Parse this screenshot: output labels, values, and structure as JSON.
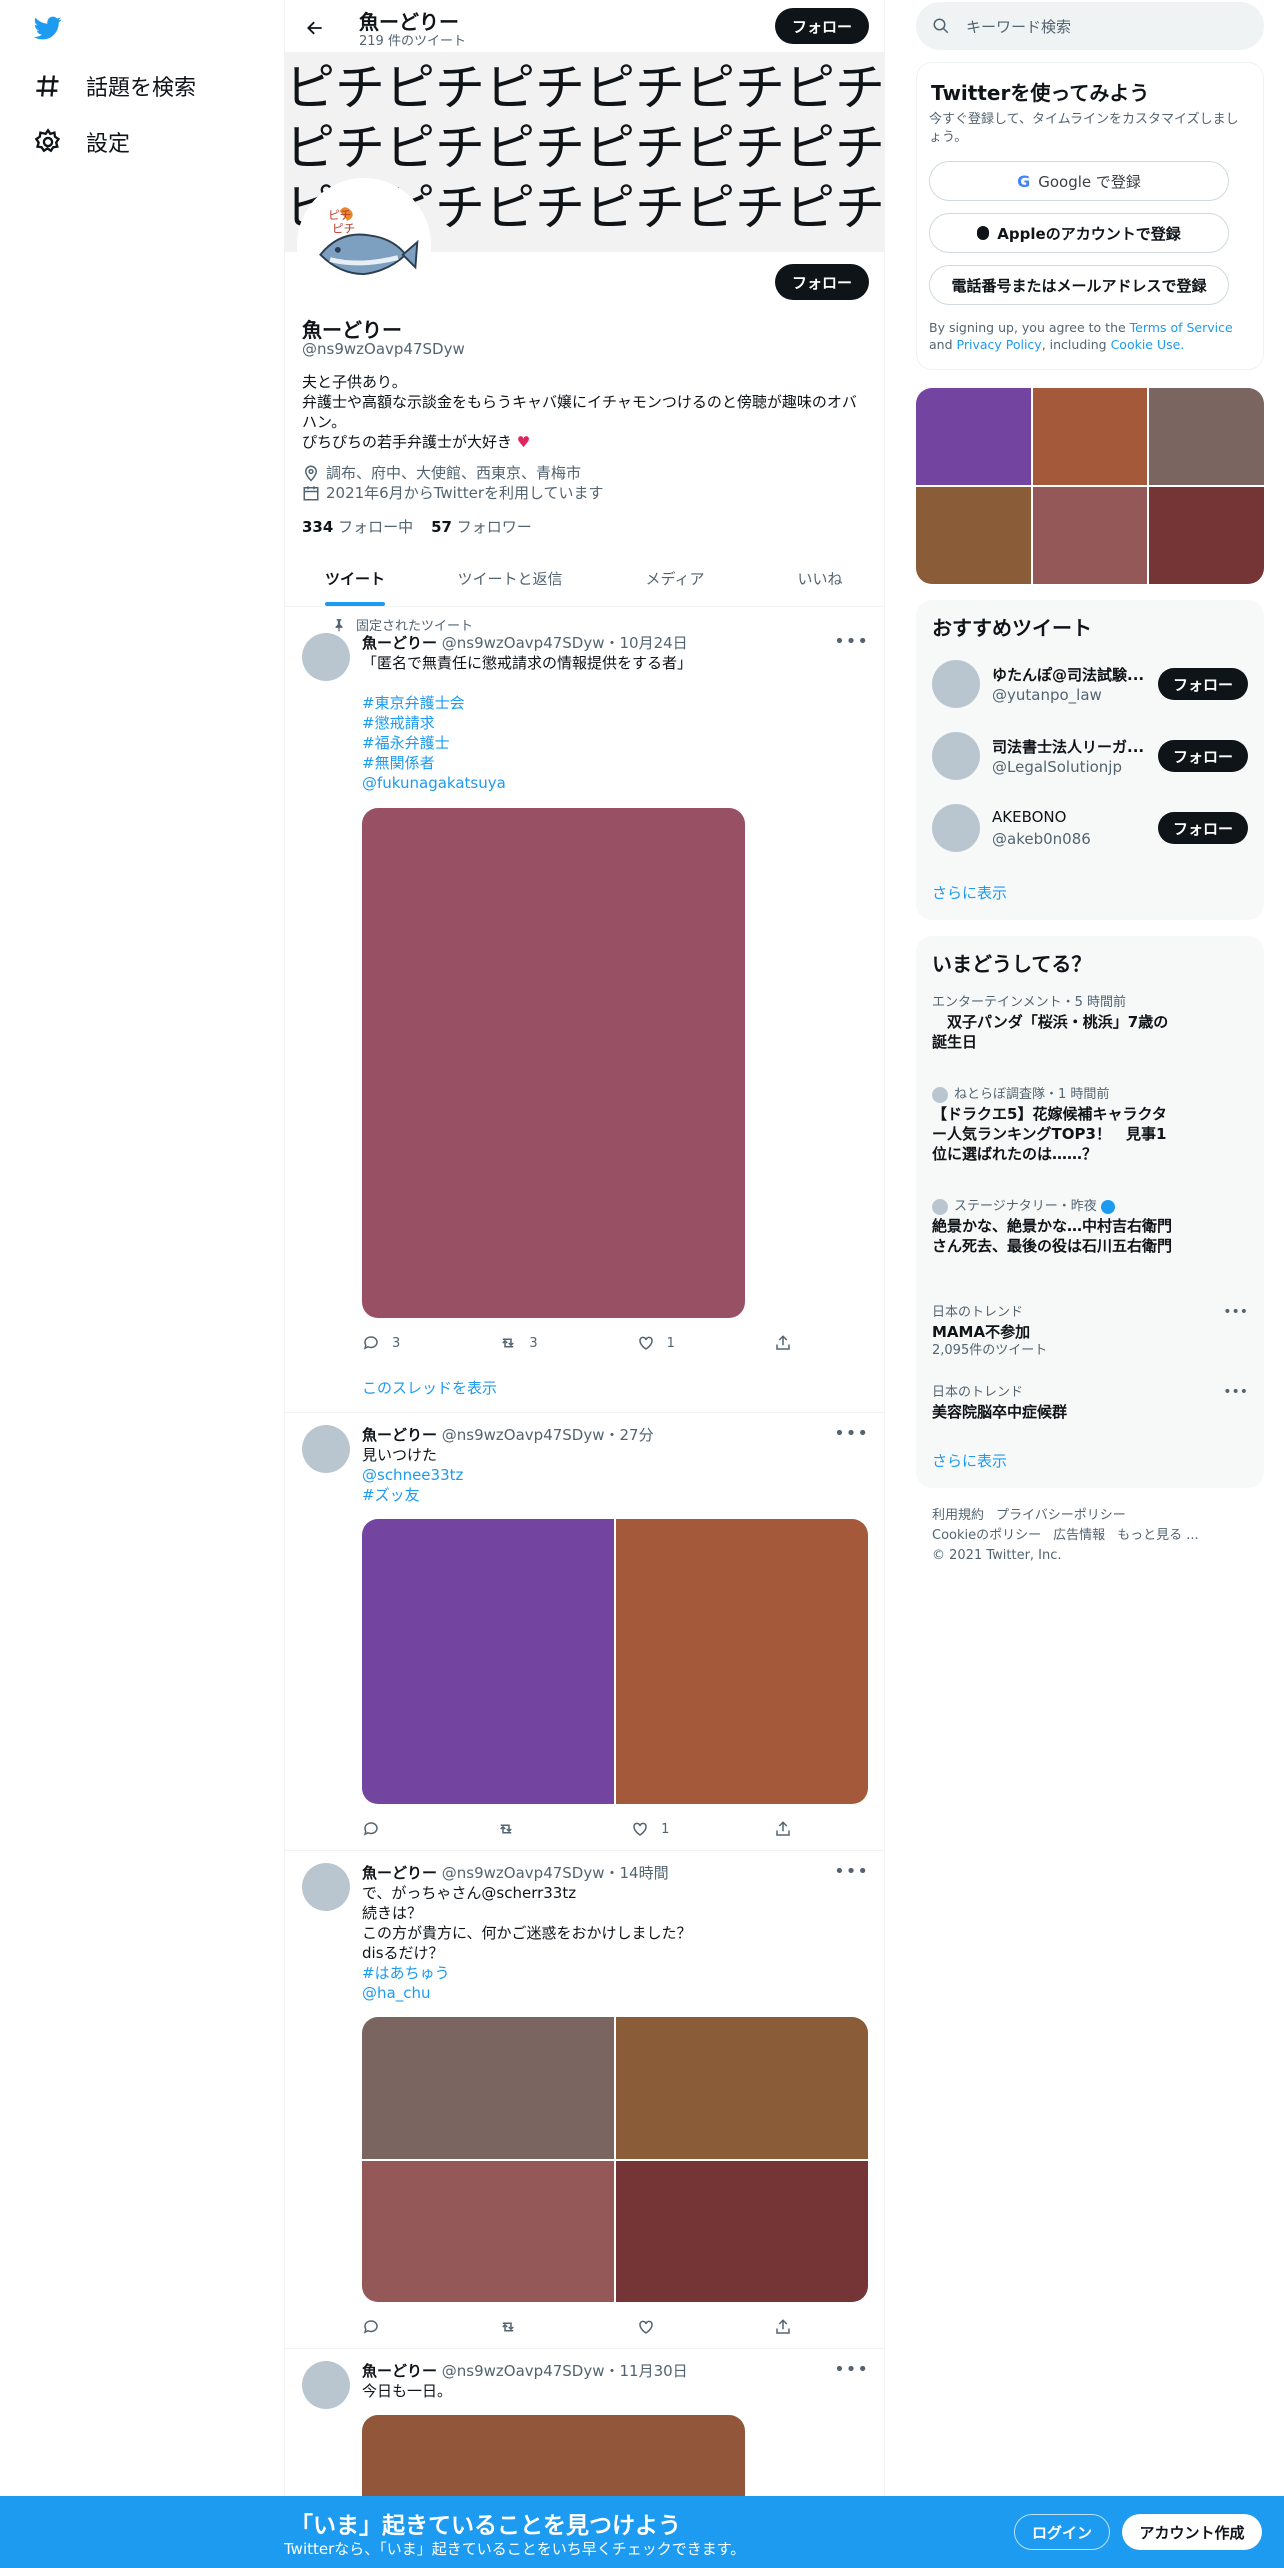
{
  "nav": {
    "items": [
      {
        "label": "話題を検索",
        "icon": "hash-icon"
      },
      {
        "label": "設定",
        "icon": "gear-icon"
      }
    ]
  },
  "header": {
    "name": "魚ーどりー",
    "tweet_count": "219 件のツイート",
    "follow_label": "フォロー"
  },
  "banner": {
    "text": "ピチピチピチピチピチピチピチピチピチピチ"
  },
  "profile": {
    "name": "魚ーどりー",
    "handle": "@ns9wzOavp47SDyw",
    "follow_label": "フォロー",
    "bio_line1": "夫と子供あり。",
    "bio_line2": "弁護士や高額な示談金をもらうキャバ嬢にイチャモンつけるのと傍聴が趣味のオバ",
    "bio_line3": "ハン。",
    "bio_line4": "ぴちぴちの若手弁護士が大好き",
    "location": "調布、府中、大使館、西東京、青梅市",
    "joined": "2021年6月からTwitterを利用しています",
    "following_count": "334",
    "following_label": "フォロー中",
    "followers_count": "57",
    "followers_label": "フォロワー"
  },
  "tabs": [
    {
      "label": "ツイート",
      "active": true
    },
    {
      "label": "ツイートと返信",
      "active": false
    },
    {
      "label": "メディア",
      "active": false
    },
    {
      "label": "いいね",
      "active": false
    }
  ],
  "tweets": [
    {
      "pinned_label": "固定されたツイート",
      "name": "魚ーどりー",
      "meta": "@ns9wzOavp47SDyw・10月24日",
      "text": "「匿名で無責任に懲戒請求の情報提供をする者」",
      "tags": [
        "#東京弁護士会",
        "#懲戒請求",
        "#福永弁護士",
        "#無関係者",
        "@fukunagakatsuya"
      ],
      "image_colors": [
        "#985064"
      ],
      "reply": "3",
      "retweet": "3",
      "like": "1",
      "thread_label": "このスレッドを表示"
    },
    {
      "name": "魚ーどりー",
      "meta": "@ns9wzOavp47SDyw・27分",
      "text": "見いつけた",
      "tags": [
        "@schnee33tz",
        "#ズッ友"
      ],
      "image_colors": [
        "#7344a0",
        "#a45a3a"
      ],
      "reply": "",
      "retweet": "",
      "like": "1"
    },
    {
      "name": "魚ーどりー",
      "meta": "@ns9wzOavp47SDyw・14時間",
      "text_lines": [
        "で、がっちゃさん@scherr33tz",
        "続きは？",
        "この方が貴方に、何かご迷惑をおかけしました？",
        "disるだけ？"
      ],
      "tags": [
        "#はあちゅう",
        "@ha_chu"
      ],
      "image_colors": [
        "#7b6560",
        "#8a5c38",
        "#955858",
        "#753436"
      ],
      "reply": "",
      "retweet": "",
      "like": ""
    },
    {
      "name": "魚ーどりー",
      "meta": "@ns9wzOavp47SDyw・11月30日",
      "text": "今日も一日。",
      "image_colors": [
        "#92563a"
      ]
    }
  ],
  "search": {
    "placeholder": "キーワード検索"
  },
  "signup": {
    "title": "Twitterを使ってみよう",
    "subtitle": "今すぐ登録して、タイムラインをカスタマイズしましょう。",
    "google_label": "Google で登録",
    "apple_label": "Appleのアカウントで登録",
    "phone_label": "電話番号またはメールアドレスで登録",
    "terms_prefix": "By signing up, you agree to the ",
    "terms_link": "Terms of Service",
    "terms_and": " and",
    "privacy_link": "Privacy Policy",
    "including": ", including ",
    "cookie_link": "Cookie Use."
  },
  "media_grid": {
    "colors": [
      "#7344a0",
      "#a45a3a",
      "#7b6560",
      "#8a5c38",
      "#955858",
      "#753436"
    ]
  },
  "recommended": {
    "title": "おすすめツイート",
    "follow_label": "フォロー",
    "users": [
      {
        "name": "ゆたんぽ@司法試験...",
        "handle": "@yutanpo_law"
      },
      {
        "name": "司法書士法人リーガ...",
        "handle": "@LegalSolutionjp"
      },
      {
        "name": "AKEBONO",
        "handle": "@akeb0n086"
      }
    ],
    "show_more": "さらに表示"
  },
  "trends": {
    "title": "いまどうしてる？",
    "items": [
      {
        "cat": "エンターテインメント・5 時間前",
        "title": "　双子パンダ「桜浜・桃浜」7歳の誕生日"
      },
      {
        "cat": "ねとらぼ調査隊・1 時間前",
        "title": "【ドラクエ5】花嫁候補キャラクター人気ランキングTOP3！　見事1位に選ばれたのは……？"
      },
      {
        "cat": "ステージナタリー・昨夜",
        "title": "絶景かな、絶景かな…中村吉右衛門さん死去、最後の役は石川五右衛門"
      },
      {
        "cat": "日本のトレンド",
        "title": "MAMA不参加",
        "count": "2,095件のツイート"
      },
      {
        "cat": "日本のトレンド",
        "title": "美容院脳卒中症候群"
      }
    ],
    "show_more": "さらに表示"
  },
  "footer": {
    "links1": [
      "利用規約",
      "プライバシーポリシー"
    ],
    "links2": [
      "Cookieのポリシー",
      "広告情報",
      "もっと見る ..."
    ],
    "copyright": "© 2021 Twitter, Inc."
  },
  "bottom_bar": {
    "headline": "「いま」起きていることを見つけよう",
    "sub": "Twitterなら、「いま」起きていることをいち早くチェックできます。",
    "login": "ログイン",
    "signup": "アカウント作成"
  }
}
